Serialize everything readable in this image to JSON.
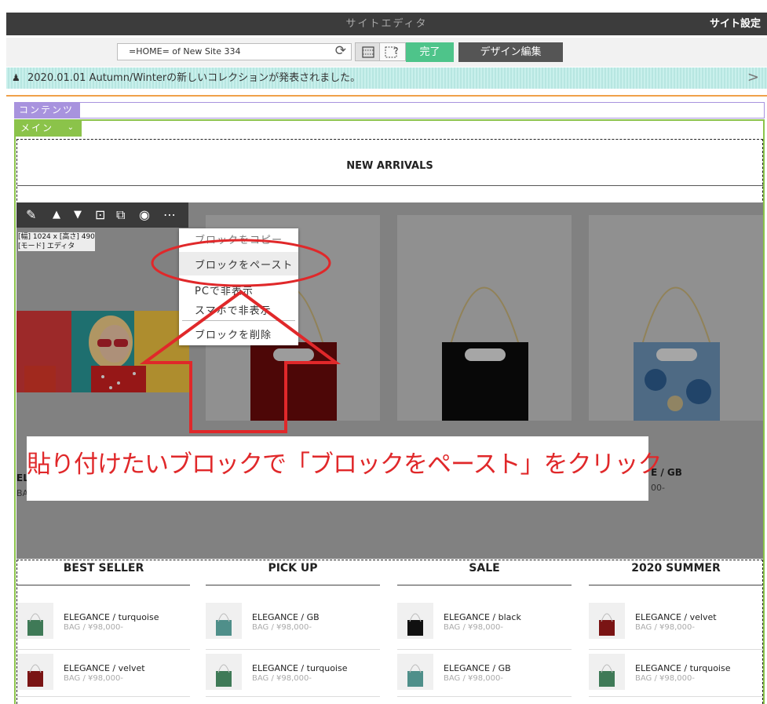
{
  "topbar": {
    "title": "サイトエディタ",
    "settings": "サイト設定"
  },
  "toolbar": {
    "url": "=HOME= of New Site 334",
    "reload_icon": "reload-icon",
    "done": "完了",
    "design_edit": "デザイン編集"
  },
  "notice": {
    "text": "2020.01.01 Autumn/Winterの新しいコレクションが発表されました。"
  },
  "tags": {
    "contents": "コンテンツ",
    "main": "メイン"
  },
  "new_arrivals": {
    "title": "NEW ARRIVALS",
    "block_info": {
      "size": "[幅] 1024 x [高さ] 490",
      "mode": "[モード] エディタ"
    },
    "block_toolbar_icons": [
      "pencil-icon",
      "arrow-up-icon",
      "arrow-down-icon",
      "add-block-icon",
      "copy-icon",
      "eye-icon",
      "more-icon"
    ],
    "context_menu": [
      "ブロックをコピー",
      "ブロックをペースト",
      "PCで非表示",
      "スマホで非表示",
      "ブロックを削除"
    ],
    "products": [
      {
        "name": "EL",
        "sub": "BA"
      },
      {
        "name": "E / GB",
        "sub": "00-"
      }
    ],
    "caption": "貼り付けたいブロックで「ブロックをペースト」をクリック"
  },
  "columns": [
    {
      "title": "BEST SELLER",
      "items": [
        {
          "name": "ELEGANCE / turquoise",
          "sub": "BAG / ¥98,000-",
          "color": "#3f7a57"
        },
        {
          "name": "ELEGANCE / velvet",
          "sub": "BAG / ¥98,000-",
          "color": "#7a1414"
        }
      ]
    },
    {
      "title": "PICK UP",
      "items": [
        {
          "name": "ELEGANCE / GB",
          "sub": "BAG / ¥98,000-",
          "color": "#4f8f8a"
        },
        {
          "name": "ELEGANCE / turquoise",
          "sub": "BAG / ¥98,000-",
          "color": "#3f7a57"
        }
      ]
    },
    {
      "title": "SALE",
      "items": [
        {
          "name": "ELEGANCE / black",
          "sub": "BAG / ¥98,000-",
          "color": "#111111"
        },
        {
          "name": "ELEGANCE / GB",
          "sub": "BAG / ¥98,000-",
          "color": "#4f8f8a"
        }
      ]
    },
    {
      "title": "2020 SUMMER",
      "items": [
        {
          "name": "ELEGANCE / velvet",
          "sub": "BAG / ¥98,000-",
          "color": "#7a1414"
        },
        {
          "name": "ELEGANCE / turquoise",
          "sub": "BAG / ¥98,000-",
          "color": "#3f7a57"
        }
      ]
    }
  ],
  "colors": {
    "accent_green": "#4ec48a",
    "annotation_red": "#e0282a",
    "main_tag": "#8bc34a",
    "contents_tag": "#a893de"
  }
}
